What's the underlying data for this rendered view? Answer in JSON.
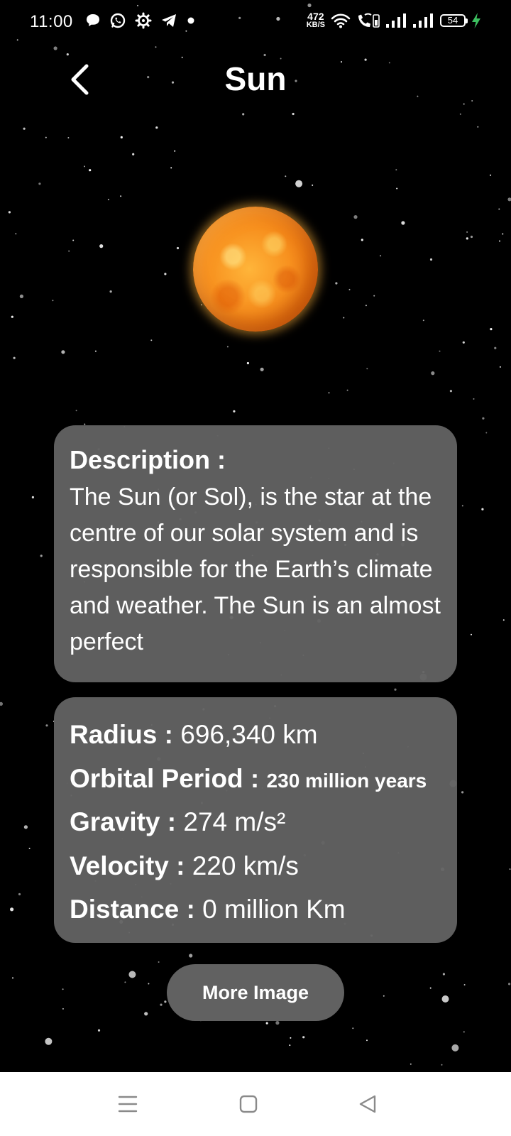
{
  "status_bar": {
    "time": "11:00",
    "net_speed_value": "472",
    "net_speed_unit": "KB/S",
    "battery_level": "54",
    "left_icons": [
      "chat-bubble-icon",
      "whatsapp-icon",
      "settings-gear-icon",
      "telegram-icon",
      "dot-icon"
    ],
    "right_icons": [
      "wifi-icon",
      "volte-call-icon",
      "signal-bars-icon",
      "signal-bars-icon",
      "battery-icon",
      "charging-bolt-icon"
    ]
  },
  "header": {
    "title": "Sun",
    "back_icon": "chevron-left-icon"
  },
  "description": {
    "heading": "Description :",
    "text": "The Sun (or Sol), is the star at the centre of our solar system and is responsible for the Earth’s climate and weather. The Sun is an almost perfect"
  },
  "stats": [
    {
      "label": "Radius :",
      "value": "696,340 km",
      "size": "normal"
    },
    {
      "label": "Orbital Period :",
      "value": "230 million years",
      "size": "small"
    },
    {
      "label": "Gravity :",
      "value": "274 m/s²",
      "size": "normal"
    },
    {
      "label": "Velocity :",
      "value": "220 km/s",
      "size": "normal"
    },
    {
      "label": "Distance :",
      "value": "0 million Km",
      "size": "normal"
    }
  ],
  "more_button": {
    "label": "More Image"
  },
  "nav_bar": {
    "icons": [
      "menu-icon",
      "home-square-icon",
      "back-triangle-icon"
    ]
  },
  "colors": {
    "background": "#000000",
    "card": "#626262",
    "button": "#616161",
    "charging": "#3cc060",
    "nav_bar": "#ffffff",
    "nav_icon": "#8a8a8a"
  }
}
